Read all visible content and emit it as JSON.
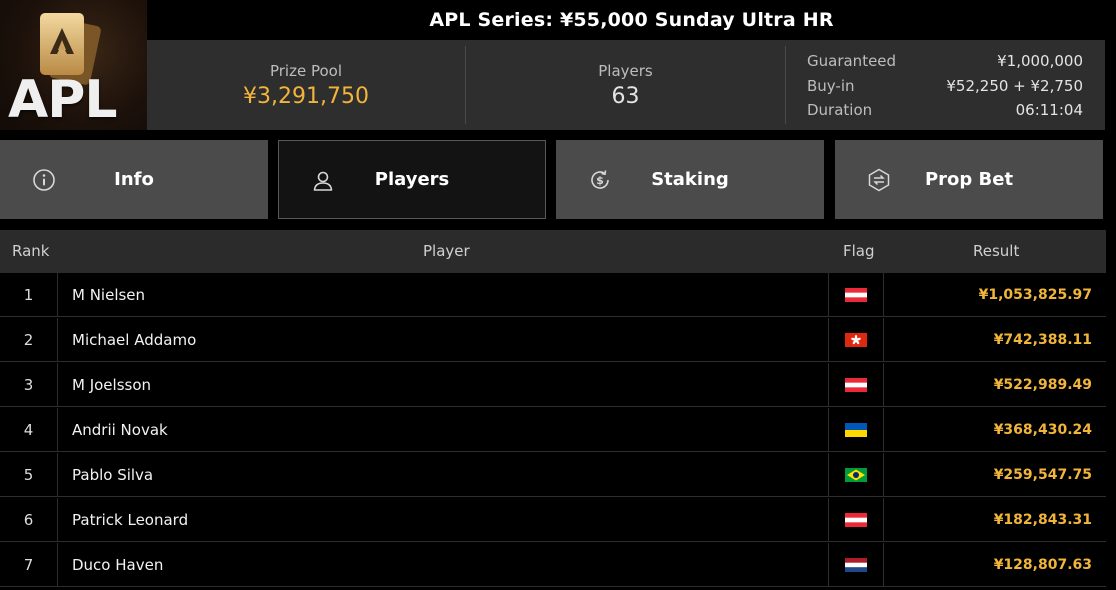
{
  "header": {
    "logo_text": "APL",
    "title": "APL Series: ¥55,000 Sunday Ultra HR",
    "prize_pool_label": "Prize Pool",
    "prize_pool_value": "¥3,291,750",
    "players_label": "Players",
    "players_value": "63",
    "details": [
      {
        "label": "Guaranteed",
        "value": "¥1,000,000"
      },
      {
        "label": "Buy-in",
        "value": "¥52,250 + ¥2,750"
      },
      {
        "label": "Duration",
        "value": "06:11:04"
      }
    ],
    "colors": {
      "accent": "#f2b53b",
      "bar": "#2e2e2e"
    }
  },
  "tabs": [
    {
      "label": "Info",
      "icon": "info-icon",
      "active": false
    },
    {
      "label": "Players",
      "icon": "user-icon",
      "active": true
    },
    {
      "label": "Staking",
      "icon": "dollar-refresh-icon",
      "active": false
    },
    {
      "label": "Prop Bet",
      "icon": "swap-hexagon-icon",
      "active": false
    }
  ],
  "table": {
    "columns": {
      "rank": "Rank",
      "player": "Player",
      "flag": "Flag",
      "result": "Result"
    },
    "rows": [
      {
        "rank": "1",
        "player": "M Nielsen",
        "flag": "austria-flag-icon",
        "result": "¥1,053,825.97"
      },
      {
        "rank": "2",
        "player": "Michael Addamo",
        "flag": "hong-kong-flag-icon",
        "result": "¥742,388.11"
      },
      {
        "rank": "3",
        "player": "M Joelsson",
        "flag": "austria-flag-icon",
        "result": "¥522,989.49"
      },
      {
        "rank": "4",
        "player": "Andrii Novak",
        "flag": "ukraine-flag-icon",
        "result": "¥368,430.24"
      },
      {
        "rank": "5",
        "player": "Pablo Silva",
        "flag": "brazil-flag-icon",
        "result": "¥259,547.75"
      },
      {
        "rank": "6",
        "player": "Patrick Leonard",
        "flag": "austria-flag-icon",
        "result": "¥182,843.31"
      },
      {
        "rank": "7",
        "player": "Duco Haven",
        "flag": "netherlands-flag-icon",
        "result": "¥128,807.63"
      }
    ]
  }
}
